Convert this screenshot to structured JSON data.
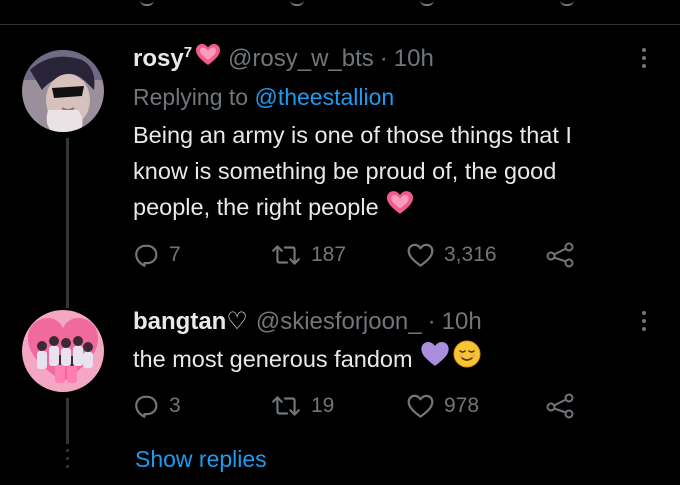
{
  "colors": {
    "background": "#000000",
    "text": "#e7e9ea",
    "muted": "#71767b",
    "link": "#1d9bf0",
    "thread_line": "#333639",
    "pink_heart": "#f91880",
    "purple_heart": "#a98edc"
  },
  "tweets": [
    {
      "name": "rosy",
      "name_sup": "7",
      "name_emoji": "pink-heart-emoji",
      "handle": "@rosy_w_bts",
      "separator": "·",
      "time": "10h",
      "replying_prefix": "Replying to",
      "replying_handle": "@theestallion",
      "text_lines": [
        "Being an army is one of those things that I",
        "know is something be proud of, the good",
        "people, the right people"
      ],
      "text_emojis": [
        "pink-heart-emoji"
      ],
      "replies": "7",
      "retweets": "187",
      "likes": "3,316"
    },
    {
      "name": "bangtan♡",
      "handle": "@skiesforjoon_",
      "separator": "·",
      "time": "10h",
      "text": "the most generous fandom",
      "text_emojis": [
        "purple-heart-emoji",
        "relieved-face-emoji"
      ],
      "replies": "3",
      "retweets": "19",
      "likes": "978"
    }
  ],
  "show_replies_label": "Show replies",
  "icons": {
    "reply": "reply-icon",
    "retweet": "retweet-icon",
    "like": "heart-icon",
    "share": "share-icon",
    "more": "more-icon"
  }
}
